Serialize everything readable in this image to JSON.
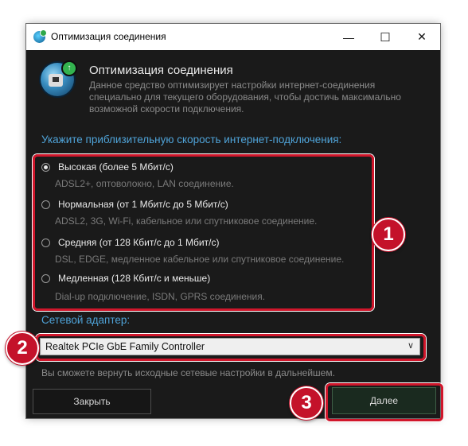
{
  "window": {
    "title": "Оптимизация соединения",
    "minimize_glyph": "—",
    "maximize_glyph": "☐",
    "close_glyph": "✕"
  },
  "header": {
    "title": "Оптимизация соединения",
    "description": "Данное средство оптимизирует настройки интернет-соединения специально для текущего оборудования, чтобы достичь максимально возможной скорости подключения."
  },
  "speed": {
    "label": "Укажите приблизительную скорость интернет-подключения:",
    "options": [
      {
        "label": "Высокая (более 5 Мбит/с)",
        "sub": "ADSL2+, оптоволокно, LAN соединение.",
        "selected": true
      },
      {
        "label": "Нормальная (от 1 Мбит/с до 5 Мбит/с)",
        "sub": "ADSL2, 3G, Wi-Fi, кабельное или спутниковое соединение.",
        "selected": false
      },
      {
        "label": "Средняя (от 128 Кбит/с до 1 Мбит/с)",
        "sub": "DSL, EDGE, медленное кабельное или спутниковое соединение.",
        "selected": false
      },
      {
        "label": "Медленная (128 Кбит/с и меньше)",
        "sub": "Dial-up подключение, ISDN, GPRS соединения.",
        "selected": false
      }
    ]
  },
  "adapter": {
    "label": "Сетевой адаптер:",
    "selected": "Realtek PCIe GbE Family Controller"
  },
  "note": "Вы сможете вернуть исходные сетевые настройки в дальнейшем.",
  "buttons": {
    "close_label": "Закрыть",
    "next_label": "Далее"
  },
  "annotations": [
    "1",
    "2",
    "3"
  ],
  "colors": {
    "highlight": "#d0162b",
    "section_label": "#4fa3d8"
  }
}
